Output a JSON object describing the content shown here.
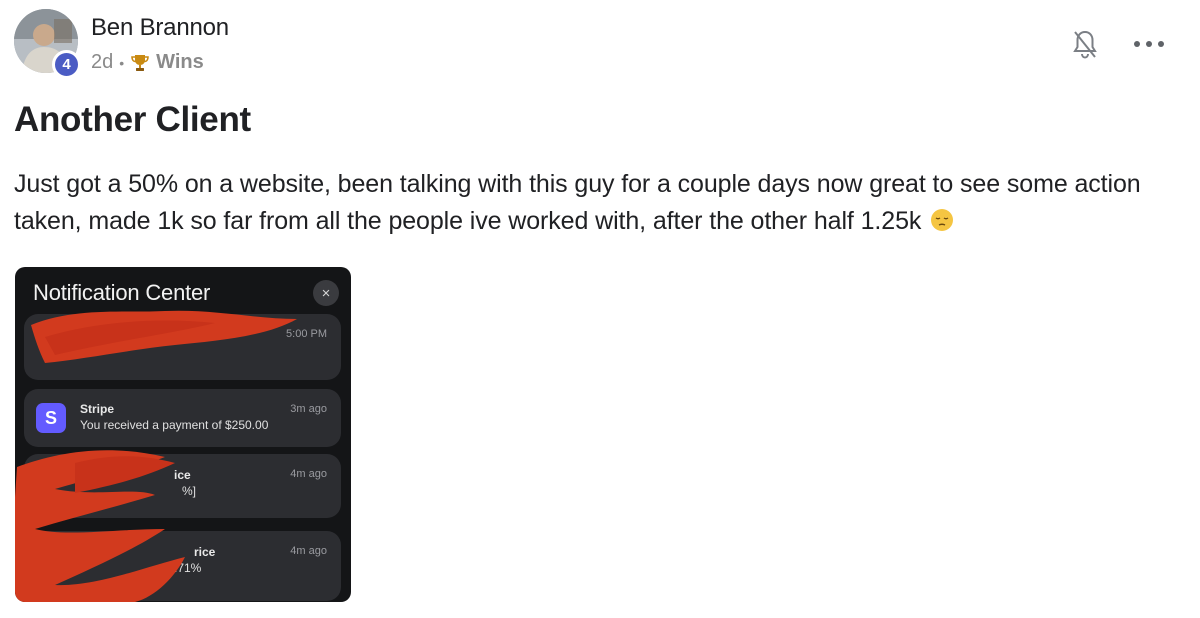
{
  "post": {
    "author": "Ben Brannon",
    "level": "4",
    "age": "2d",
    "category": "Wins",
    "title": "Another Client",
    "body": "Just got a 50% on a website, been talking with this guy for a couple days now great to see some action taken, made 1k so far from all the people ive worked with, after the other half 1.25k",
    "icons": {
      "bell": "bell-off-icon",
      "more": "more-horizontal-icon",
      "trophy": "trophy-icon",
      "emoji": "pensive-face-emoji"
    }
  },
  "attachment": {
    "header": "Notification Center",
    "close": "×",
    "notifications": [
      {
        "time": "5:00 PM"
      },
      {
        "icon_letter": "S",
        "app": "Stripe",
        "message": "You received a payment of $250.00",
        "time": "3m ago"
      },
      {
        "app": "ice",
        "message": "%]",
        "time": "4m ago"
      },
      {
        "app": "rice",
        "message": ".71%",
        "time": "4m ago"
      }
    ],
    "colors": {
      "stripe": "#635bff",
      "redaction": "#d23a1e",
      "accent": "#4b5cc4"
    }
  }
}
